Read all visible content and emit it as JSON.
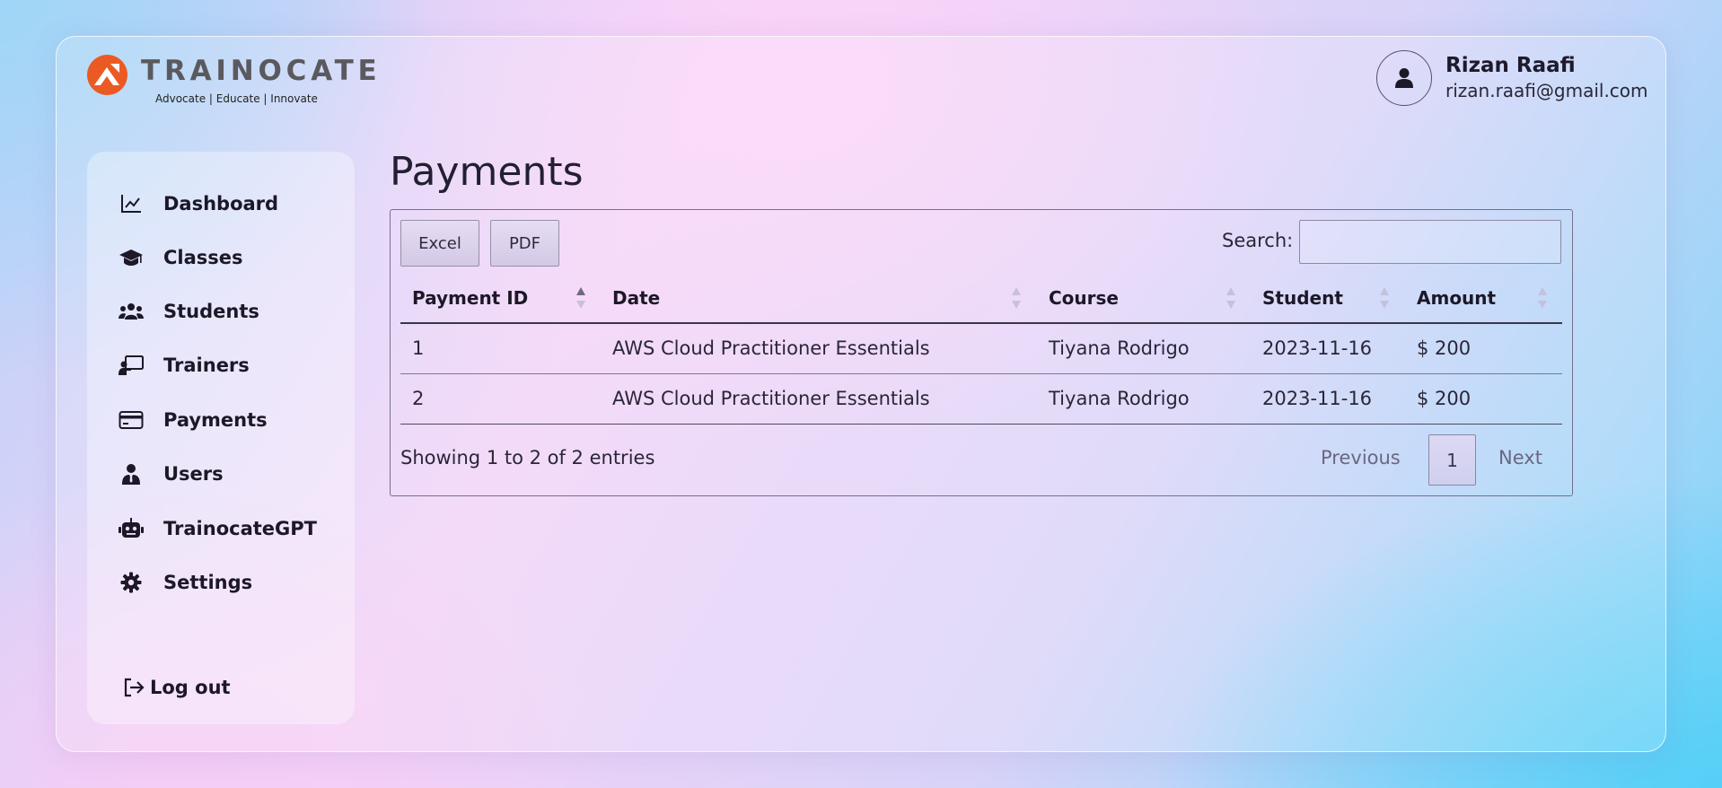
{
  "brand": {
    "name": "TRAINOCATE",
    "tagline": "Advocate | Educate | Innovate",
    "logo_color": "#ec5a24"
  },
  "user": {
    "name": "Rizan Raafi",
    "email": "rizan.raafi@gmail.com",
    "icon": "user-icon"
  },
  "sidebar": {
    "items": [
      {
        "label": "Dashboard",
        "icon": "chart-line-icon"
      },
      {
        "label": "Classes",
        "icon": "graduation-cap-icon"
      },
      {
        "label": "Students",
        "icon": "users-icon"
      },
      {
        "label": "Trainers",
        "icon": "chalkboard-teacher-icon"
      },
      {
        "label": "Payments",
        "icon": "credit-card-icon"
      },
      {
        "label": "Users",
        "icon": "user-tie-icon"
      },
      {
        "label": "TrainocateGPT",
        "icon": "robot-icon"
      },
      {
        "label": "Settings",
        "icon": "gear-icon"
      }
    ],
    "active": "Payments",
    "logout_label": "Log out"
  },
  "main": {
    "title": "Payments",
    "export_buttons": {
      "excel": "Excel",
      "pdf": "PDF"
    },
    "search": {
      "label": "Search:",
      "value": ""
    },
    "table": {
      "columns": [
        "Payment ID",
        "Date",
        "Course",
        "Student",
        "Amount"
      ],
      "sorted_column": "Payment ID",
      "rows": [
        [
          "1",
          "AWS Cloud Practitioner Essentials",
          "Tiyana Rodrigo",
          "2023-11-16",
          "$ 200"
        ],
        [
          "2",
          "AWS Cloud Practitioner Essentials",
          "Tiyana Rodrigo",
          "2023-11-16",
          "$ 200"
        ]
      ]
    },
    "info": "Showing 1 to 2 of 2 entries",
    "pagination": {
      "previous": "Previous",
      "current": "1",
      "next": "Next"
    }
  }
}
